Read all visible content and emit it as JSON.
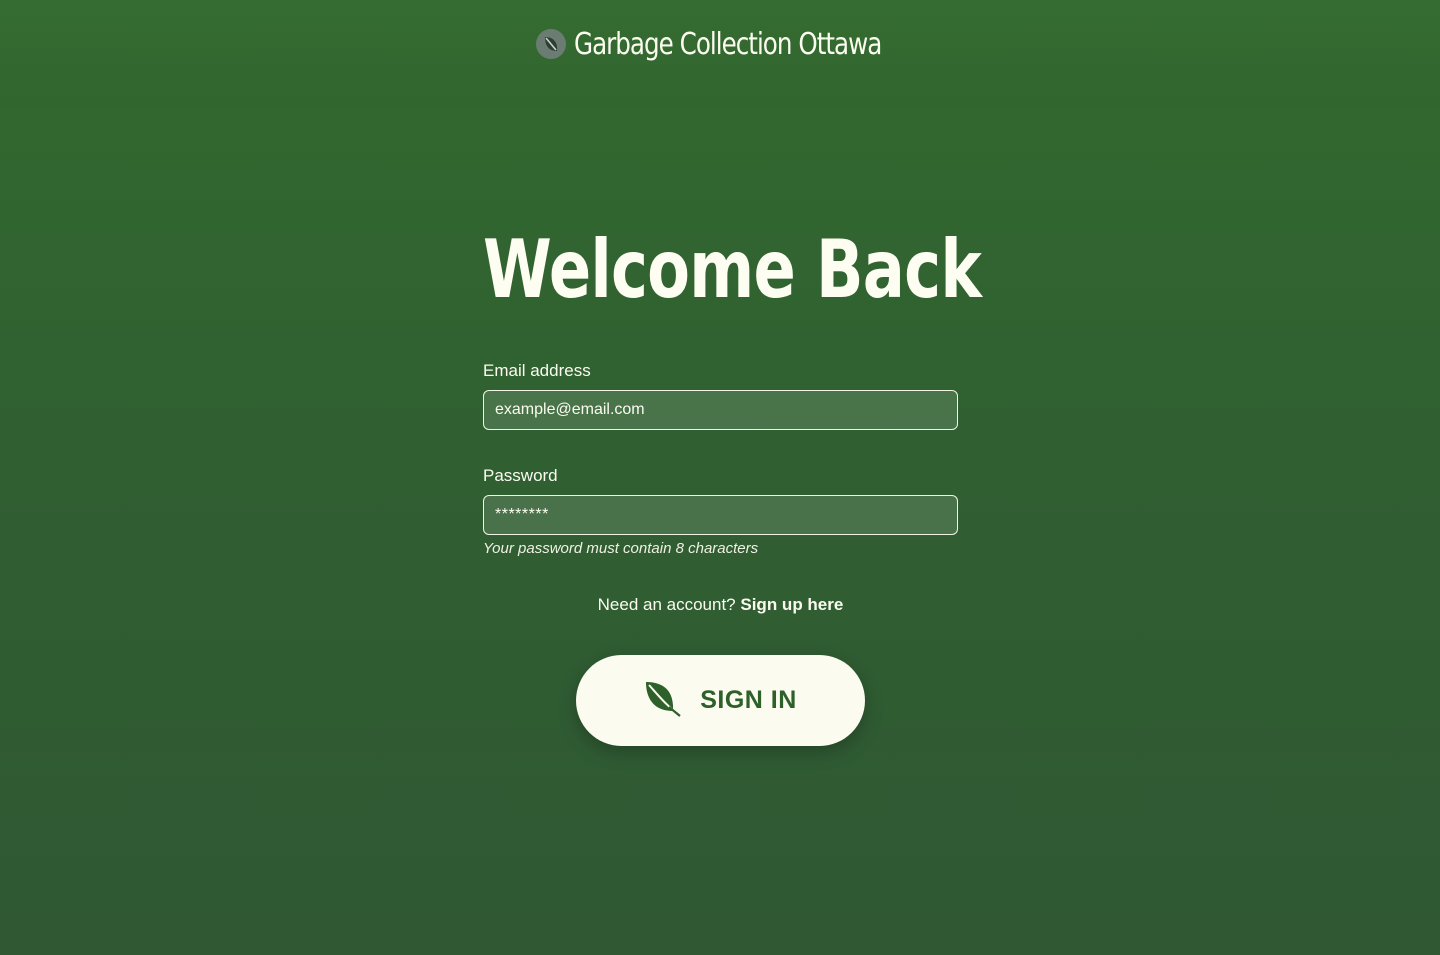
{
  "header": {
    "title": "Garbage Collection Ottawa",
    "logo_icon": "leaf-badge-icon"
  },
  "form": {
    "heading": "Welcome Back",
    "email": {
      "label": "Email address",
      "value": "example@email.com"
    },
    "password": {
      "label": "Password",
      "value": "********",
      "hint": "Your password must contain 8 characters"
    },
    "signup": {
      "prompt": "Need an account?",
      "link": "Sign up here"
    },
    "submit": {
      "label": "SIGN IN",
      "icon": "leaf-icon"
    }
  },
  "colors": {
    "background": "#326a2e",
    "text": "#fbfbf0",
    "button_bg": "#fbfbef",
    "button_text": "#2e6029"
  }
}
